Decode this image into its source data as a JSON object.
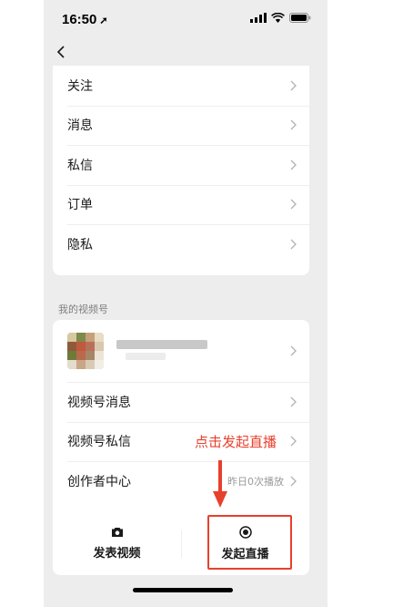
{
  "status_bar": {
    "time": "16:50"
  },
  "settings_items": [
    {
      "label": "关注"
    },
    {
      "label": "消息"
    },
    {
      "label": "私信"
    },
    {
      "label": "订单"
    },
    {
      "label": "隐私"
    }
  ],
  "section_title": "我的视频号",
  "channel_items": [
    {
      "label": "视频号消息",
      "sub": ""
    },
    {
      "label": "视频号私信",
      "sub": ""
    },
    {
      "label": "创作者中心",
      "sub": "昨日0次播放"
    }
  ],
  "annotation": {
    "text": "点击发起直播",
    "color": "#e8402c"
  },
  "actions": {
    "post_video": "发表视频",
    "go_live": "发起直播"
  }
}
